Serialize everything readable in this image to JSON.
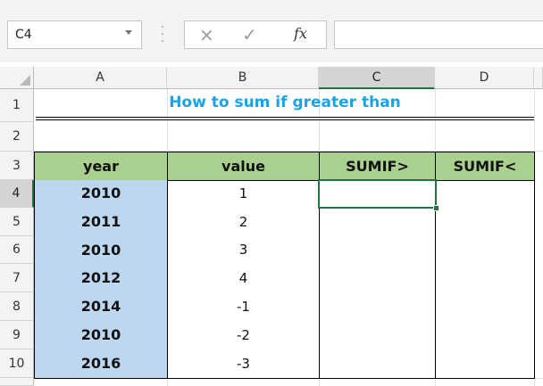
{
  "namebox": {
    "value": "C4"
  },
  "formula_bar": {
    "fx_label": "fx",
    "cancel_icon": "×",
    "enter_icon": "✓",
    "value": ""
  },
  "columns": [
    {
      "label": "A"
    },
    {
      "label": "B"
    },
    {
      "label": "C"
    },
    {
      "label": "D"
    }
  ],
  "rows": [
    "1",
    "2",
    "3",
    "4",
    "5",
    "6",
    "7",
    "8",
    "9",
    "10"
  ],
  "selected_column": "C",
  "selected_row": "4",
  "title": "How to sum if greater than",
  "table": {
    "headers": [
      "year",
      "value",
      "SUMIF>",
      "SUMIF<"
    ],
    "years": [
      "2010",
      "2011",
      "2010",
      "2012",
      "2014",
      "2010",
      "2016"
    ],
    "values": [
      "1",
      "2",
      "3",
      "4",
      "-1",
      "-2",
      "-3"
    ]
  }
}
